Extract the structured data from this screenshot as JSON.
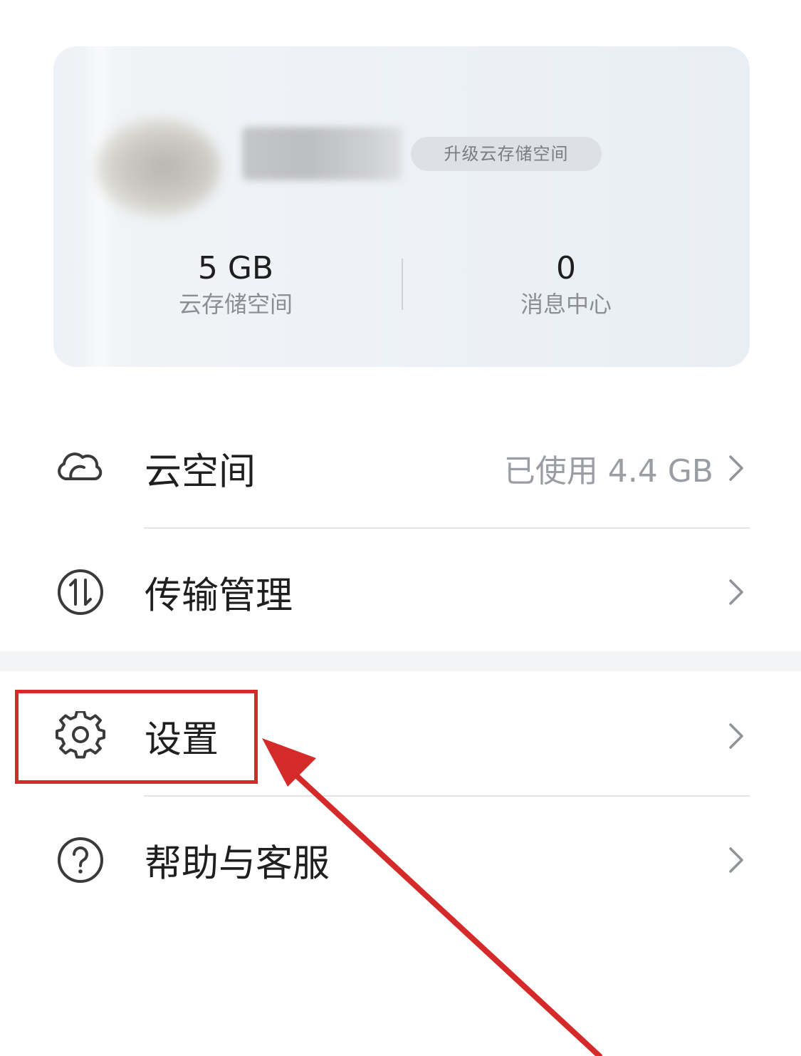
{
  "profile_card": {
    "upgrade_label": "升级云存储空间",
    "storage_value": "5 GB",
    "storage_label": "云存储空间",
    "messages_value": "0",
    "messages_label": "消息中心"
  },
  "menu": {
    "items": [
      {
        "label": "云空间",
        "value": "已使用 4.4 GB",
        "icon": "cloud-icon"
      },
      {
        "label": "传输管理",
        "value": "",
        "icon": "transfer-icon"
      },
      {
        "label": "设置",
        "value": "",
        "icon": "gear-icon"
      },
      {
        "label": "帮助与客服",
        "value": "",
        "icon": "help-icon"
      }
    ]
  },
  "annotation": {
    "color": "#d52a2a",
    "highlighted_item": "设置"
  }
}
